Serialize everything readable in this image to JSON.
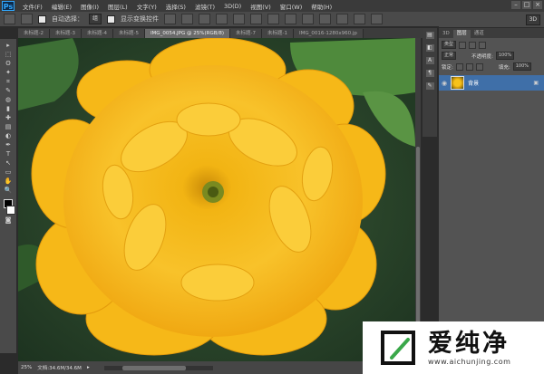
{
  "app": {
    "logo": "Ps"
  },
  "menu": [
    "文件(F)",
    "编辑(E)",
    "图像(I)",
    "图层(L)",
    "文字(Y)",
    "选择(S)",
    "滤镜(T)",
    "3D(D)",
    "视图(V)",
    "窗口(W)",
    "帮助(H)"
  ],
  "window_controls": [
    "–",
    "□",
    "×"
  ],
  "options": {
    "auto_select_label": "自动选择：",
    "auto_select_value": "组",
    "show_transform_label": "显示变换控件",
    "workspace": "3D"
  },
  "tabs": [
    {
      "label": "未标题-2",
      "active": false
    },
    {
      "label": "未标题-3",
      "active": false
    },
    {
      "label": "未标题-4",
      "active": false
    },
    {
      "label": "未标题-5",
      "active": false
    },
    {
      "label": "IMG_0054.JPG @ 25%(RGB/8)",
      "active": true
    },
    {
      "label": "未标题-7",
      "active": false
    },
    {
      "label": "未标题-1",
      "active": false
    },
    {
      "label": "IMG_0016-1280x960.jp",
      "active": false
    }
  ],
  "tools": [
    "▸",
    "⬚",
    "ʘ",
    "✦",
    "⌗",
    "✎",
    "◍",
    "▮",
    "✚",
    "▤",
    "◐",
    "✒",
    "T",
    "↖",
    "▭",
    "✋",
    "🔍"
  ],
  "status": {
    "zoom": "25%",
    "doc": "文档:34.6M/34.6M"
  },
  "panels": {
    "tabs": [
      "3D",
      "图层",
      "通道"
    ],
    "active_tab": "图层",
    "filter_label": "类型",
    "mode": "正常",
    "opacity_label": "不透明度:",
    "opacity": "100%",
    "lock_label": "锁定:",
    "fill_label": "填充:",
    "fill": "100%",
    "layer_name": "背景"
  },
  "watermark": {
    "text": "爱纯净",
    "url": "www.aichunjing.com"
  },
  "colors": {
    "layer_highlight": "#3f6fa8",
    "flower": "#f7b91a"
  }
}
